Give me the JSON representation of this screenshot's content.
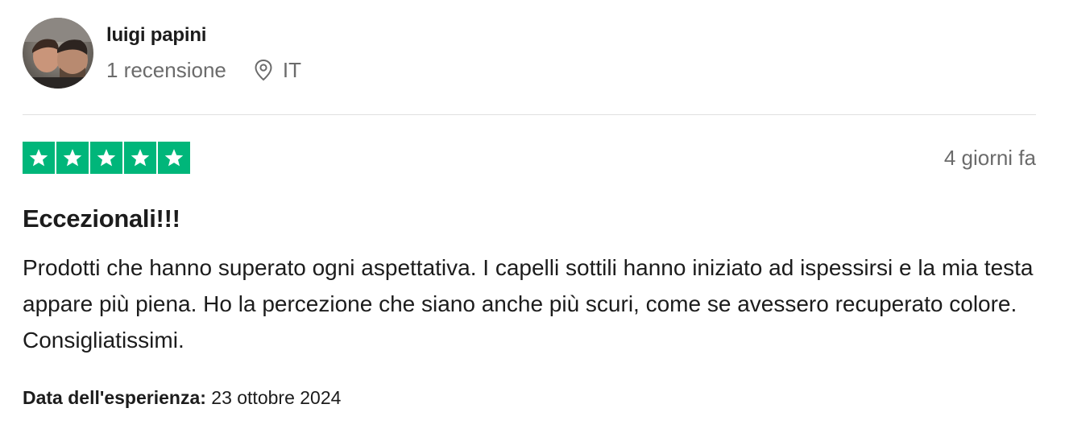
{
  "reviewer": {
    "name": "luigi papini",
    "review_count": "1 recensione",
    "country": "IT",
    "avatar_icon": "avatar-photo"
  },
  "rating": {
    "stars": 5,
    "max_stars": 5,
    "star_color": "#00b67a",
    "posted": "4 giorni fa"
  },
  "review": {
    "title": "Eccezionali!!!",
    "body": "Prodotti che hanno superato ogni aspettativa. I capelli sottili hanno iniziato ad ispessirsi e la mia testa appare più piena. Ho la percezione che siano anche più scuri, come se avessero recuperato colore. Consigliatissimi.",
    "experience_label": "Data dell'esperienza:",
    "experience_date": "23 ottobre 2024"
  },
  "icons": {
    "location": "location-pin-icon",
    "star": "star-icon"
  }
}
